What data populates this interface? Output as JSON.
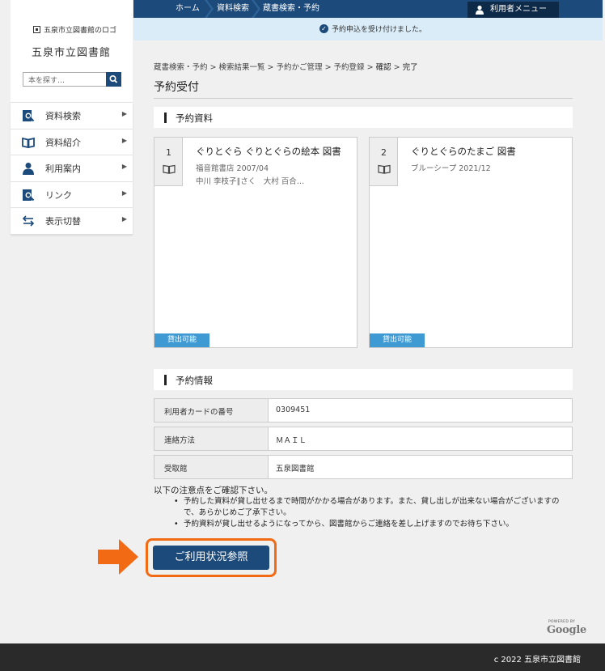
{
  "topnav": {
    "crumbs": [
      "ホーム",
      "資料検索",
      "蔵書検索・予約"
    ],
    "user_menu": "利用者メニュー"
  },
  "notice": {
    "message": "予約申込を受け付けました。"
  },
  "sidebar": {
    "logo_text": "五泉市立図書館のロゴ",
    "library_name": "五泉市立図書館",
    "search_placeholder": "本を探す…",
    "menu": [
      {
        "label": "資料検索",
        "icon": "search-book-icon"
      },
      {
        "label": "資料紹介",
        "icon": "open-book-icon"
      },
      {
        "label": "利用案内",
        "icon": "person-icon"
      },
      {
        "label": "リンク",
        "icon": "link-icon"
      },
      {
        "label": "表示切替",
        "icon": "switch-arrows-icon"
      }
    ]
  },
  "breadcrumb": {
    "items": [
      "蔵書検索・予約",
      "検索結果一覧",
      "予約かご管理",
      "予約登録",
      "確認",
      "完了"
    ],
    "separator": " > "
  },
  "page_title": "予約受付",
  "reserved_section": {
    "title": "予約資料",
    "items": [
      {
        "number": "1",
        "title": "ぐりとぐら ぐりとぐらの絵本 図書",
        "publisher": "福音館書店 2007/04",
        "author": "中川 李枝子∥さく　大村 百合…",
        "status": "貸出可能"
      },
      {
        "number": "2",
        "title": "ぐりとぐらのたまご 図書",
        "publisher": "ブルーシープ 2021/12",
        "author": "",
        "status": "貸出可能"
      }
    ]
  },
  "info_section": {
    "title": "予約情報",
    "rows": [
      {
        "label": "利用者カードの番号",
        "value": "0309451"
      },
      {
        "label": "連絡方法",
        "value": "ＭＡＩＬ"
      },
      {
        "label": "受取館",
        "value": "五泉図書館"
      }
    ]
  },
  "notes": {
    "lead": "以下の注意点をご確認下さい。",
    "items": [
      "予約した資料が貸し出せるまで時間がかかる場合があります。また、貸し出しが出来ない場合がございますので、あらかじめご了承下さい。",
      "予約資料が貸し出せるようになってから、図書館からご連絡を差し上げますのでお待ち下さい。"
    ]
  },
  "status_button": "ご利用状況参照",
  "google": {
    "powered_by": "POWERED BY",
    "brand": "Google"
  },
  "footer": {
    "copyright": "c 2022 五泉市立図書館"
  },
  "colors": {
    "primary": "#1c4a7a",
    "available": "#3f9ad4",
    "highlight": "#f26a14"
  }
}
